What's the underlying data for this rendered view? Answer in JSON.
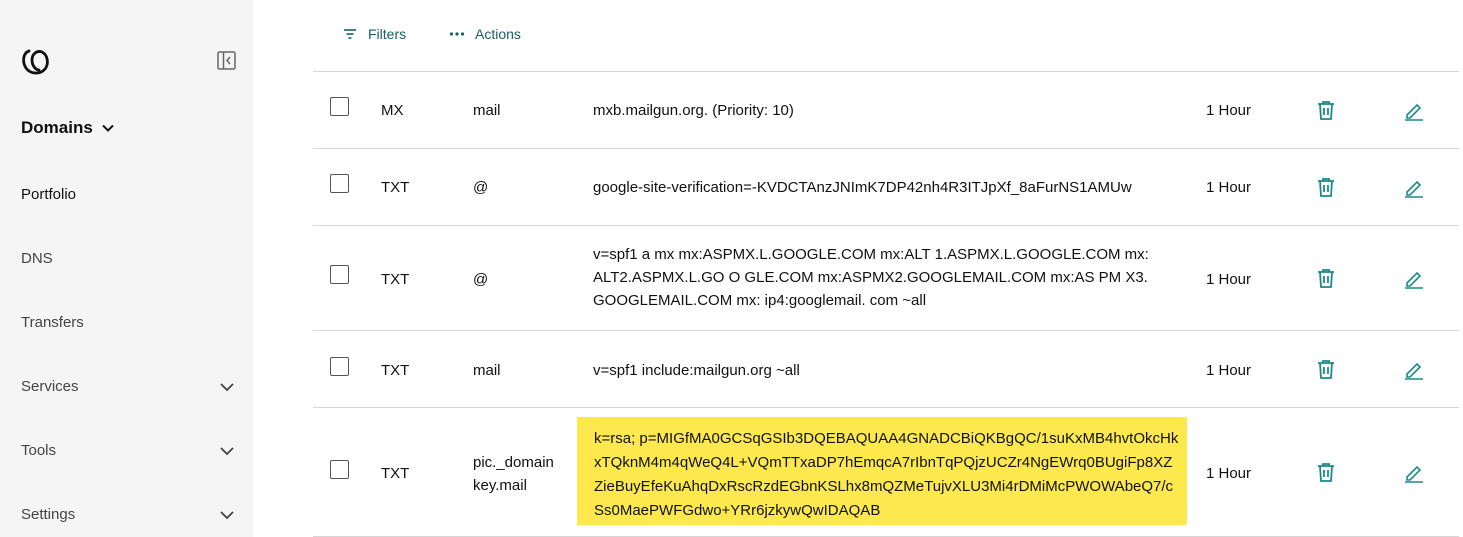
{
  "sidebar": {
    "logo_icon": "godaddy-logo-icon",
    "collapse_icon": "sidebar-collapse-icon",
    "section_title": "Domains",
    "items": [
      {
        "label": "Portfolio",
        "active": true,
        "expandable": false
      },
      {
        "label": "DNS",
        "active": false,
        "expandable": false
      },
      {
        "label": "Transfers",
        "active": false,
        "expandable": false
      },
      {
        "label": "Services",
        "active": false,
        "expandable": true
      },
      {
        "label": "Tools",
        "active": false,
        "expandable": true
      },
      {
        "label": "Settings",
        "active": false,
        "expandable": true
      }
    ]
  },
  "toolbar": {
    "filters_label": "Filters",
    "actions_label": "Actions"
  },
  "records": [
    {
      "type": "MX",
      "name": "mail",
      "value": "mxb.mailgun.org. (Priority: 10)",
      "ttl": "1 Hour",
      "highlighted": false
    },
    {
      "type": "TXT",
      "name": "@",
      "value": "google-site-verification=-KVDCTAnzJNImK7DP42nh4R3ITJpXf_8aFurNS1AMUw",
      "ttl": "1 Hour",
      "highlighted": false
    },
    {
      "type": "TXT",
      "name": "@",
      "value": "v=spf1 a mx mx:ASPMX.L.GOOGLE.COM mx:ALT 1.ASPMX.L.GOOGLE.COM mx: ALT2.ASPMX.L.GO O GLE.COM mx:ASPMX2.GOOGLEMAIL.COM mx:AS PM X3. GOOGLEMAIL.COM mx: ip4:googlemail. com ~all",
      "ttl": "1 Hour",
      "highlighted": false
    },
    {
      "type": "TXT",
      "name": "mail",
      "value": "v=spf1 include:mailgun.org ~all",
      "ttl": "1 Hour",
      "highlighted": false
    },
    {
      "type": "TXT",
      "name": "pic._domainkey.mail",
      "value": "k=rsa; p=MIGfMA0GCSqGSIb3DQEBAQUAA4GNADCBiQKBgQC/1suKxMB4hvtOkcHkxTQknM4m4qWeQ4L+VQmTTxaDP7hEmqcA7rIbnTqPQjzUCZr4NgEWrq0BUgiFp8XZZieBuyEfeKuAhqDxRscRzdEGbnKSLhx8mQZMeTujvXLU3Mi4rDMiMcPWOWAbeQ7/cSs0MaePWFGdwo+YRr6jzkywQwIDAQAB",
      "ttl": "1 Hour",
      "highlighted": true
    }
  ],
  "colors": {
    "accent": "#1b5f63",
    "icon_teal": "#1d8a8a",
    "highlight": "#fde94e",
    "sidebar_bg": "#f5f5f5"
  }
}
